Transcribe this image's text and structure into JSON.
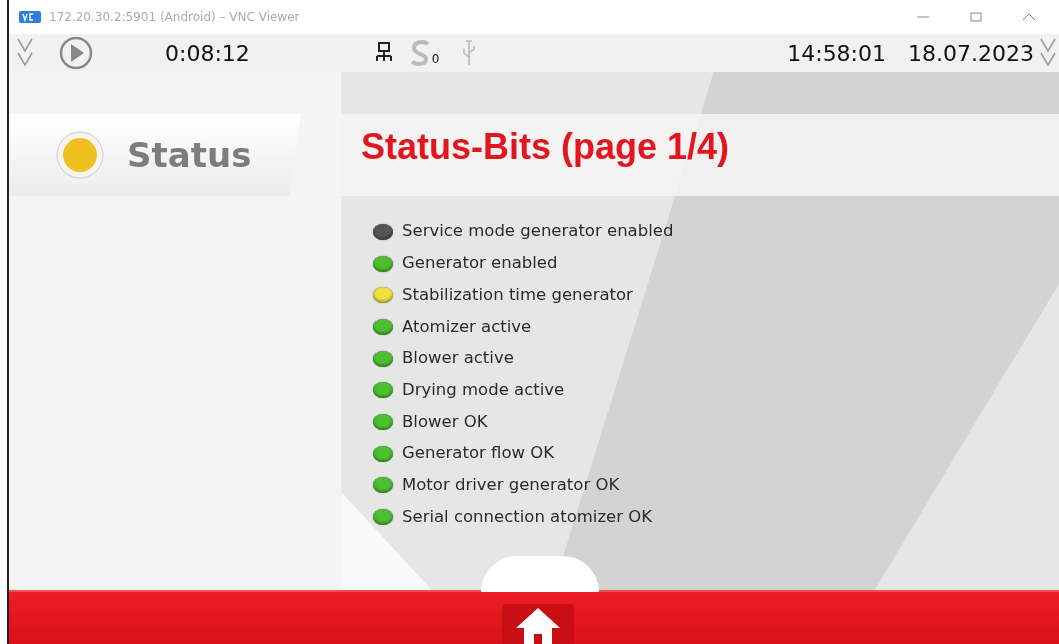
{
  "window": {
    "title": "172.20.30.2:5901 (Android) – VNC Viewer"
  },
  "top_bar": {
    "elapsed": "0:08:12",
    "subscript": "0",
    "time": "14:58:01",
    "date": "18.07.2023"
  },
  "header": {
    "section": "Status",
    "indicator": {
      "color": "#f0c020"
    },
    "title": "Status-Bits (page 1/4)"
  },
  "status_bits": [
    {
      "label": "Service mode generator enabled",
      "color": "#555555"
    },
    {
      "label": "Generator enabled",
      "color": "#4cc030"
    },
    {
      "label": "Stabilization time generator",
      "color": "#f0e040"
    },
    {
      "label": "Atomizer active",
      "color": "#4cc030"
    },
    {
      "label": "Blower active",
      "color": "#4cc030"
    },
    {
      "label": "Drying mode active",
      "color": "#4cc030"
    },
    {
      "label": "Blower OK",
      "color": "#4cc030"
    },
    {
      "label": "Generator flow OK",
      "color": "#4cc030"
    },
    {
      "label": "Motor driver generator OK",
      "color": "#4cc030"
    },
    {
      "label": "Serial connection atomizer OK",
      "color": "#4cc030"
    }
  ]
}
